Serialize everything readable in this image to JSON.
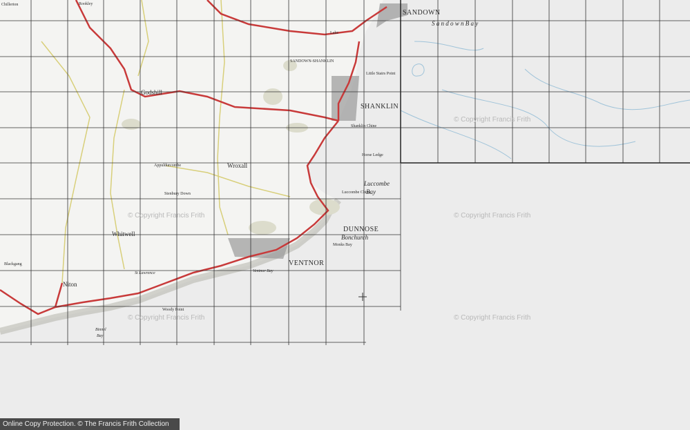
{
  "map": {
    "colors": {
      "background": "#ececec",
      "land": "#f4f4f2",
      "roads_main": "#c83a3a",
      "roads_minor": "#e6e08a",
      "woodland": "#d8d8c8",
      "grid": "#333333",
      "sea_contours": "#9fc3d9",
      "text": "#2a2a2a"
    },
    "labels": {
      "sandown": "SANDOWN",
      "sandown_bay": "S a n d o w n   B a y",
      "shanklin": "SHANKLIN",
      "ventnor": "VENTNOR",
      "dunnose": "DUNNOSE",
      "bonchurch": "Bonchurch",
      "luccombe_bay": "Luccombe",
      "luccombe_bay_2": "Bay",
      "godshill": "Godshill",
      "wroxall": "Wroxall",
      "whitwell": "Whitwell",
      "niton": "Niton",
      "st_lawrence": "St Lawrence",
      "ventnor_bay": "Ventnor Bay",
      "binnel_bay": "Binnel",
      "binnel_bay_2": "Bay",
      "little_stairs_point": "Little Stairs Point",
      "horse_ledge": "Horse Ledge",
      "shanklin_chine": "Shanklin Chine",
      "luccombe_chine": "Luccombe Chine",
      "monks_bay": "Monks Bay",
      "woody_point": "Woody Point",
      "rookley": "Rookley",
      "chillerton": "Chillerton",
      "appuldurcombe": "Appuldurcombe",
      "stenbury_down": "Stenbury Down",
      "blackgang": "Blackgang",
      "sandown_shanklin": "SANDOWN-SHANKLIN",
      "lake": "Lake"
    },
    "watermarks": [
      "© Copyright Francis Frith",
      "© Copyright Francis Frith",
      "© Copyright Francis Frith",
      "© Copyright Francis Frith",
      "© Copyright Francis Frith"
    ],
    "footer": "Online Copy Protection. © The Francis Frith Collection"
  }
}
